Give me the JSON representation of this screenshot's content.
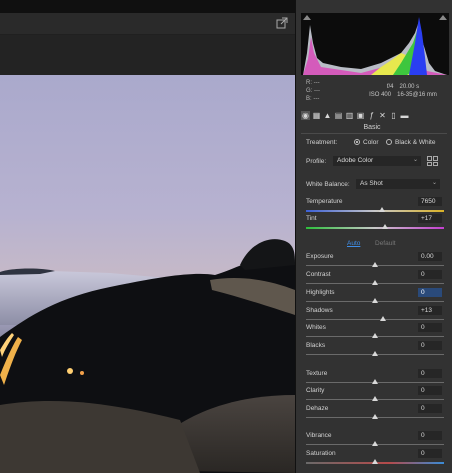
{
  "toolbar": {
    "export_icon": "open-in-photoshop-icon"
  },
  "histogram": {
    "rgb_labels": [
      "R:",
      "G:",
      "B:"
    ],
    "rgb_values": [
      "---",
      "---",
      "---"
    ],
    "aperture": "f/4",
    "shutter": "20.00 s",
    "iso": "ISO 400",
    "lens": "16-35@16 mm"
  },
  "tabs": [
    "basic-aperture-icon",
    "tone-curve-icon",
    "detail-icon",
    "hsl-icon",
    "split-toning-icon",
    "lens-corrections-icon",
    "fx-icon",
    "calibration-icon",
    "presets-icon",
    "snapshots-icon"
  ],
  "section": {
    "title": "Basic"
  },
  "treatment": {
    "label": "Treatment:",
    "color": "Color",
    "bw": "Black & White"
  },
  "profile": {
    "label": "Profile:",
    "value": "Adobe Color"
  },
  "white_balance": {
    "label": "White Balance:",
    "value": "As Shot"
  },
  "auto_default": {
    "auto": "Auto",
    "default": "Default"
  },
  "sliders": {
    "temperature": {
      "label": "Temperature",
      "value": "7650",
      "position": 0.55
    },
    "tint": {
      "label": "Tint",
      "value": "+17",
      "position": 0.57
    },
    "exposure": {
      "label": "Exposure",
      "value": "0.00",
      "position": 0.5
    },
    "contrast": {
      "label": "Contrast",
      "value": "0",
      "position": 0.5
    },
    "highlights": {
      "label": "Highlights",
      "value": "0",
      "position": 0.5
    },
    "shadows": {
      "label": "Shadows",
      "value": "+13",
      "position": 0.56
    },
    "whites": {
      "label": "Whites",
      "value": "0",
      "position": 0.5
    },
    "blacks": {
      "label": "Blacks",
      "value": "0",
      "position": 0.5
    },
    "texture": {
      "label": "Texture",
      "value": "0",
      "position": 0.5
    },
    "clarity": {
      "label": "Clarity",
      "value": "0",
      "position": 0.5
    },
    "dehaze": {
      "label": "Dehaze",
      "value": "0",
      "position": 0.5
    },
    "vibrance": {
      "label": "Vibrance",
      "value": "0",
      "position": 0.5
    },
    "saturation": {
      "label": "Saturation",
      "value": "0",
      "position": 0.5
    }
  },
  "colors": {
    "accent": "#3f8ee8",
    "panel": "#323232",
    "field": "#262626"
  }
}
